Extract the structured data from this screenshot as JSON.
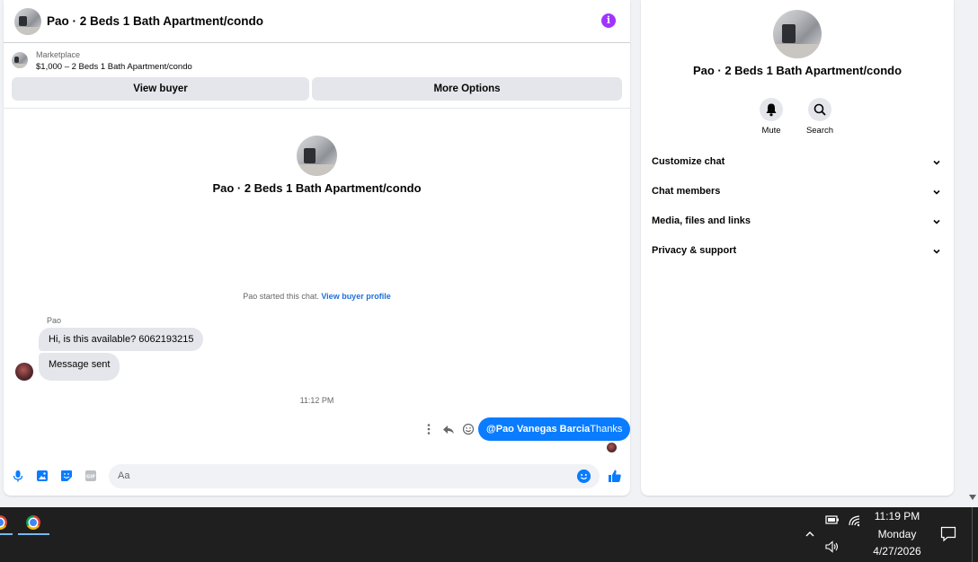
{
  "chat": {
    "title": "Pao · 2 Beds 1 Bath Apartment/condo",
    "marketplace_label": "Marketplace",
    "listing": "$1,000 – 2 Beds 1 Bath Apartment/condo",
    "view_buyer_label": "View buyer",
    "more_options_label": "More Options",
    "center_title": "Pao · 2 Beds 1 Bath Apartment/condo",
    "started_text": "Pao started this chat.",
    "view_profile_link": "View buyer profile",
    "sender_name": "Pao",
    "messages_in": [
      "Hi, is this available? 6062193215",
      "Message sent"
    ],
    "timestamp": "11:12 PM",
    "message_out_mention": "@Pao Vanegas Barcia",
    "message_out_text": "Thanks",
    "composer_placeholder": "Aa"
  },
  "info": {
    "title": "Pao · 2 Beds 1 Bath Apartment/condo",
    "mute_label": "Mute",
    "search_label": "Search",
    "sections": [
      "Customize chat",
      "Chat members",
      "Media, files and links",
      "Privacy & support"
    ]
  },
  "taskbar": {
    "time": "11:19 PM",
    "day": "Monday",
    "date": "4/27/2026"
  },
  "colors": {
    "accent_blue": "#0a7cff",
    "info_purple": "#a033ff",
    "link_blue": "#216fdb"
  }
}
